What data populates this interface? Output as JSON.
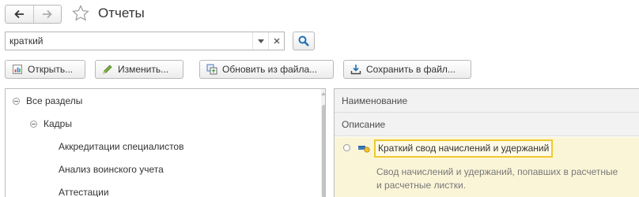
{
  "window": {
    "title": "Отчеты"
  },
  "search": {
    "value": "краткий"
  },
  "toolbar": {
    "open_label": "Открыть...",
    "edit_label": "Изменить...",
    "update_label": "Обновить из файла...",
    "save_label": "Сохранить в файл..."
  },
  "tree": {
    "items": [
      {
        "label": "Все разделы",
        "level": 0,
        "expanded": true
      },
      {
        "label": "Кадры",
        "level": 1,
        "expanded": true
      },
      {
        "label": "Аккредитации специалистов",
        "level": 2
      },
      {
        "label": "Анализ воинского учета",
        "level": 2
      },
      {
        "label": "Аттестации",
        "level": 2
      }
    ]
  },
  "list": {
    "columns": {
      "name": "Наименование",
      "description": "Описание"
    },
    "rows": [
      {
        "name": "Краткий свод начислений и удержаний",
        "description_line1": "Свод начислений и удержаний, попавших в расчетные",
        "description_line2": "и расчетные листки."
      }
    ]
  },
  "colors": {
    "selected_row_bg": "#fbf5d8",
    "highlight_border": "#f0c930",
    "search_icon": "#1f6fb5"
  },
  "icons": [
    "back-arrow-icon",
    "forward-arrow-icon",
    "star-icon",
    "dropdown-chevron-icon",
    "clear-icon",
    "search-icon",
    "report-icon",
    "pencil-icon",
    "update-from-file-icon",
    "save-to-file-icon",
    "report-item-icon"
  ]
}
